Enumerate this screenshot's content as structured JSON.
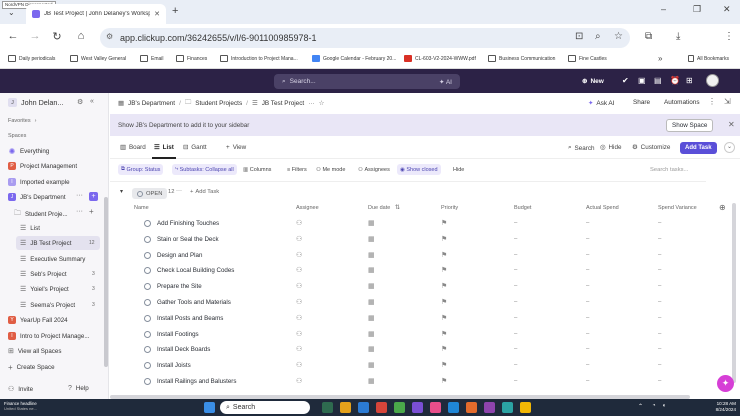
{
  "browser": {
    "notice": "NordVPN Disconnected",
    "tab_title": "JB Test Project | John Delaney's Workspace | Li...",
    "url": "app.clickup.com/36242655/v/l/6-901100985978-1",
    "profile": "JB",
    "bookmarks": [
      {
        "label": "Daily periodicals",
        "color": "#555"
      },
      {
        "label": "West Valley General",
        "color": "#555"
      },
      {
        "label": "Email",
        "color": "#555"
      },
      {
        "label": "Finances",
        "color": "#555"
      },
      {
        "label": "Introduction to Project Mana...",
        "color": "#555"
      },
      {
        "label": "Google Calendar - February 20...",
        "color": "#4285f4"
      },
      {
        "label": "CL-603-V2-2024-WWW.pdf",
        "color": "#d93025"
      },
      {
        "label": "Business Communication",
        "color": "#555"
      },
      {
        "label": "Fine Castles",
        "color": "#555"
      }
    ],
    "all_bookmarks": "All Bookmarks",
    "overflow": "»"
  },
  "cu_top": {
    "search_placeholder": "Search...",
    "ai_label": "AI",
    "new_label": "New"
  },
  "sidebar": {
    "workspace": "John Delan...",
    "favorites": "Favorites",
    "spaces_label": "Spaces",
    "items": [
      {
        "label": "Everything",
        "icon": "everything-icon",
        "color": "#7b68ee"
      },
      {
        "label": "Project Management",
        "icon": "P",
        "color": "#e05d44"
      },
      {
        "label": "Imported example",
        "icon": "I",
        "color": "#7b68ee"
      },
      {
        "label": "JB's Department",
        "icon": "J",
        "color": "#7b68ee"
      },
      {
        "label": "Student Proje...",
        "icon": "folder-icon",
        "color": "#666"
      },
      {
        "label": "List",
        "icon": "list-icon",
        "color": "#666"
      },
      {
        "label": "JB Test Project",
        "icon": "list-icon",
        "color": "#666",
        "count": "12"
      },
      {
        "label": "Executive Summary",
        "icon": "list-icon",
        "color": "#666"
      },
      {
        "label": "Seb's Project",
        "icon": "list-icon",
        "color": "#666",
        "count": "3"
      },
      {
        "label": "Yoiel's Project",
        "icon": "list-icon",
        "color": "#666",
        "count": "3"
      },
      {
        "label": "Seema's Project",
        "icon": "list-icon",
        "color": "#666",
        "count": "3"
      },
      {
        "label": "YearUp Fall 2024",
        "icon": "Y",
        "color": "#e05d44"
      },
      {
        "label": "Intro to Project Manage...",
        "icon": "I",
        "color": "#e05d44"
      },
      {
        "label": "View all Spaces",
        "icon": "grid-icon",
        "color": "#666"
      },
      {
        "label": "Create Space",
        "icon": "plus-icon",
        "color": "#666"
      }
    ],
    "invite": "Invite",
    "help": "Help"
  },
  "main": {
    "breadcrumb": [
      "JB's Department",
      "Student Projects",
      "JB Test Project"
    ],
    "ask_ai": "Ask AI",
    "share": "Share",
    "automations": "Automations",
    "banner_text": "Show JB's Department to add it to your sidebar",
    "show_space": "Show Space",
    "views": [
      "Board",
      "List",
      "Gantt",
      "View"
    ],
    "search": "Search",
    "hide": "Hide",
    "customize": "Customize",
    "add_task": "Add Task",
    "filters": {
      "group": "Group: Status",
      "subtasks": "Subtasks: Collapse all",
      "columns": "Columns",
      "filters": "Filters",
      "me_mode": "Me mode",
      "assignees": "Assignees",
      "show_closed": "Show closed",
      "hide": "Hide",
      "search_tasks": "Search tasks..."
    },
    "group": {
      "status": "OPEN",
      "count": "12",
      "add_task": "Add Task"
    },
    "columns": [
      "Name",
      "Assignee",
      "Due date",
      "Priority",
      "Budget",
      "Actual Spend",
      "Spend Variance"
    ],
    "tasks": [
      "Add Finishing Touches",
      "Stain or Seal the Deck",
      "Design and Plan",
      "Check Local Building Codes",
      "Prepare the Site",
      "Gather Tools and Materials",
      "Install Posts and Beams",
      "Install Footings",
      "Install Deck Boards",
      "Install Joists",
      "Install Railings and Balusters"
    ],
    "dash": "–"
  },
  "taskbar": {
    "weather_title": "Finance headline",
    "weather_sub": "United States ne...",
    "search": "Search",
    "time": "10:28 AM",
    "date": "8/24/2024"
  }
}
